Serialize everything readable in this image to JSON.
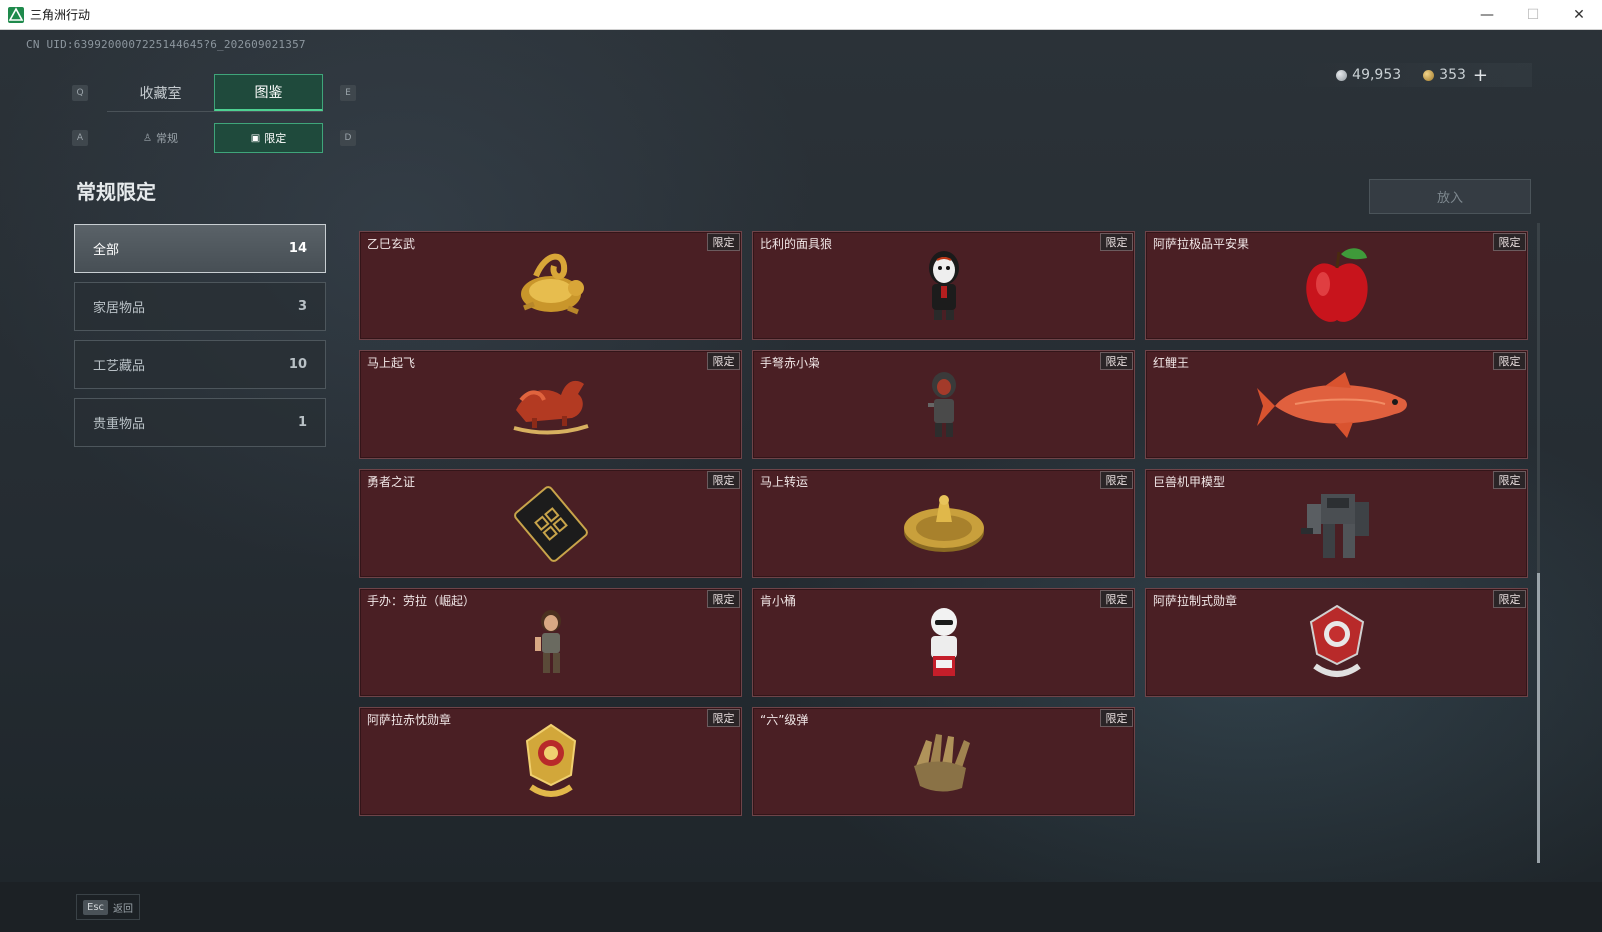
{
  "window": {
    "title": "三角洲行动",
    "minimize": "—",
    "maximize": "☐",
    "close": "✕"
  },
  "header": {
    "uid": "CN UID:6399200007225144645?6_202609021357",
    "currency": [
      {
        "icon": "silver-coin-icon",
        "value": "49,953"
      },
      {
        "icon": "gold-coin-icon",
        "value": "353"
      }
    ],
    "add_label": "+"
  },
  "tabs_main": {
    "key_left": "Q",
    "key_right": "E",
    "items": [
      {
        "label": "收藏室",
        "active": false
      },
      {
        "label": "图鉴",
        "active": true
      }
    ]
  },
  "tabs_sub": {
    "key_left": "A",
    "key_right": "D",
    "items": [
      {
        "label": "常规",
        "icon": "bottle-icon",
        "active": false
      },
      {
        "label": "限定",
        "icon": "picture-icon",
        "active": true
      }
    ]
  },
  "page_title": "常规限定",
  "place_button": "放入",
  "categories": [
    {
      "label": "全部",
      "count": "14",
      "active": true
    },
    {
      "label": "家居物品",
      "count": "3",
      "active": false
    },
    {
      "label": "工艺藏品",
      "count": "10",
      "active": false
    },
    {
      "label": "贵重物品",
      "count": "1",
      "active": false
    }
  ],
  "badge_label": "限定",
  "items": [
    {
      "name": "乙巳玄武",
      "art": "gold-dragon-turtle-icon"
    },
    {
      "name": "比利的面具狼",
      "art": "mask-figure-icon"
    },
    {
      "name": "阿萨拉极品平安果",
      "art": "red-apple-icon"
    },
    {
      "name": "马上起飞",
      "art": "red-horse-icon"
    },
    {
      "name": "手弩赤小枭",
      "art": "hooded-figure-icon"
    },
    {
      "name": "红鲤王",
      "art": "red-carp-icon"
    },
    {
      "name": "勇者之证",
      "art": "black-card-icon"
    },
    {
      "name": "马上转运",
      "art": "gold-wheel-icon"
    },
    {
      "name": "巨兽机甲模型",
      "art": "mech-robot-icon"
    },
    {
      "name": "手办：劳拉（崛起）",
      "art": "lara-figure-icon"
    },
    {
      "name": "肯小桶",
      "art": "bucket-figure-icon"
    },
    {
      "name": "阿萨拉制式勋章",
      "art": "red-medal-icon"
    },
    {
      "name": "阿萨拉赤忱勋章",
      "art": "gold-medal-icon"
    },
    {
      "name": "“六”级弹",
      "art": "bullet-hand-icon"
    }
  ],
  "footer": {
    "esc_key": "Esc",
    "esc_label": "返回"
  }
}
